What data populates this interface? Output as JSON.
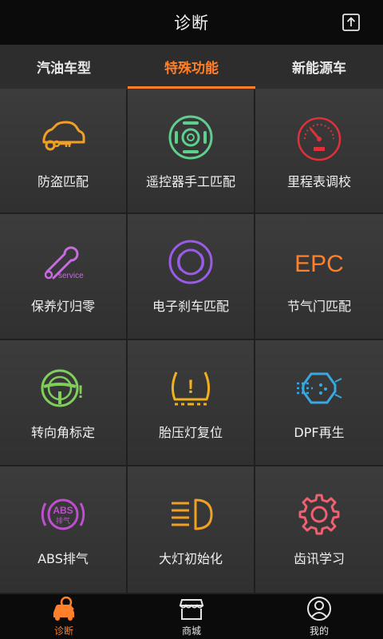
{
  "header": {
    "title": "诊断",
    "share_icon": "share-icon"
  },
  "tabs": [
    {
      "label": "汽油车型",
      "active": false
    },
    {
      "label": "特殊功能",
      "active": true
    },
    {
      "label": "新能源车",
      "active": false
    }
  ],
  "accent_color": "#ff7f2a",
  "functions": [
    {
      "label": "防盗匹配",
      "icon": "car-key-icon",
      "color": "#f0a024"
    },
    {
      "label": "遥控器手工匹配",
      "icon": "remote-control-icon",
      "color": "#5fcf8e"
    },
    {
      "label": "里程表调校",
      "icon": "odometer-icon",
      "color": "#e0303a"
    },
    {
      "label": "保养灯归零",
      "icon": "service-wrench-icon",
      "color": "#c86be0",
      "icon_text": "service"
    },
    {
      "label": "电子刹车匹配",
      "icon": "electronic-brake-icon",
      "color": "#9a5ce6"
    },
    {
      "label": "节气门匹配",
      "icon": "epc-icon",
      "color": "#ff7f2a",
      "icon_text": "EPC"
    },
    {
      "label": "转向角标定",
      "icon": "steering-wheel-icon",
      "color": "#7fcf5a",
      "icon_text": "!"
    },
    {
      "label": "胎压灯复位",
      "icon": "tire-pressure-icon",
      "color": "#f0b020",
      "icon_text": "!"
    },
    {
      "label": "DPF再生",
      "icon": "dpf-filter-icon",
      "color": "#39a8e0"
    },
    {
      "label": "ABS排气",
      "icon": "abs-icon",
      "color": "#c04ed0",
      "icon_text": "ABS",
      "icon_subtext": "排气"
    },
    {
      "label": "大灯初始化",
      "icon": "headlight-icon",
      "color": "#f0a024"
    },
    {
      "label": "齿讯学习",
      "icon": "gear-icon",
      "color": "#f06070"
    }
  ],
  "bottom_nav": [
    {
      "label": "诊断",
      "icon": "diagnosis-icon",
      "active": true
    },
    {
      "label": "商城",
      "icon": "store-icon",
      "active": false
    },
    {
      "label": "我的",
      "icon": "profile-icon",
      "active": false
    }
  ]
}
